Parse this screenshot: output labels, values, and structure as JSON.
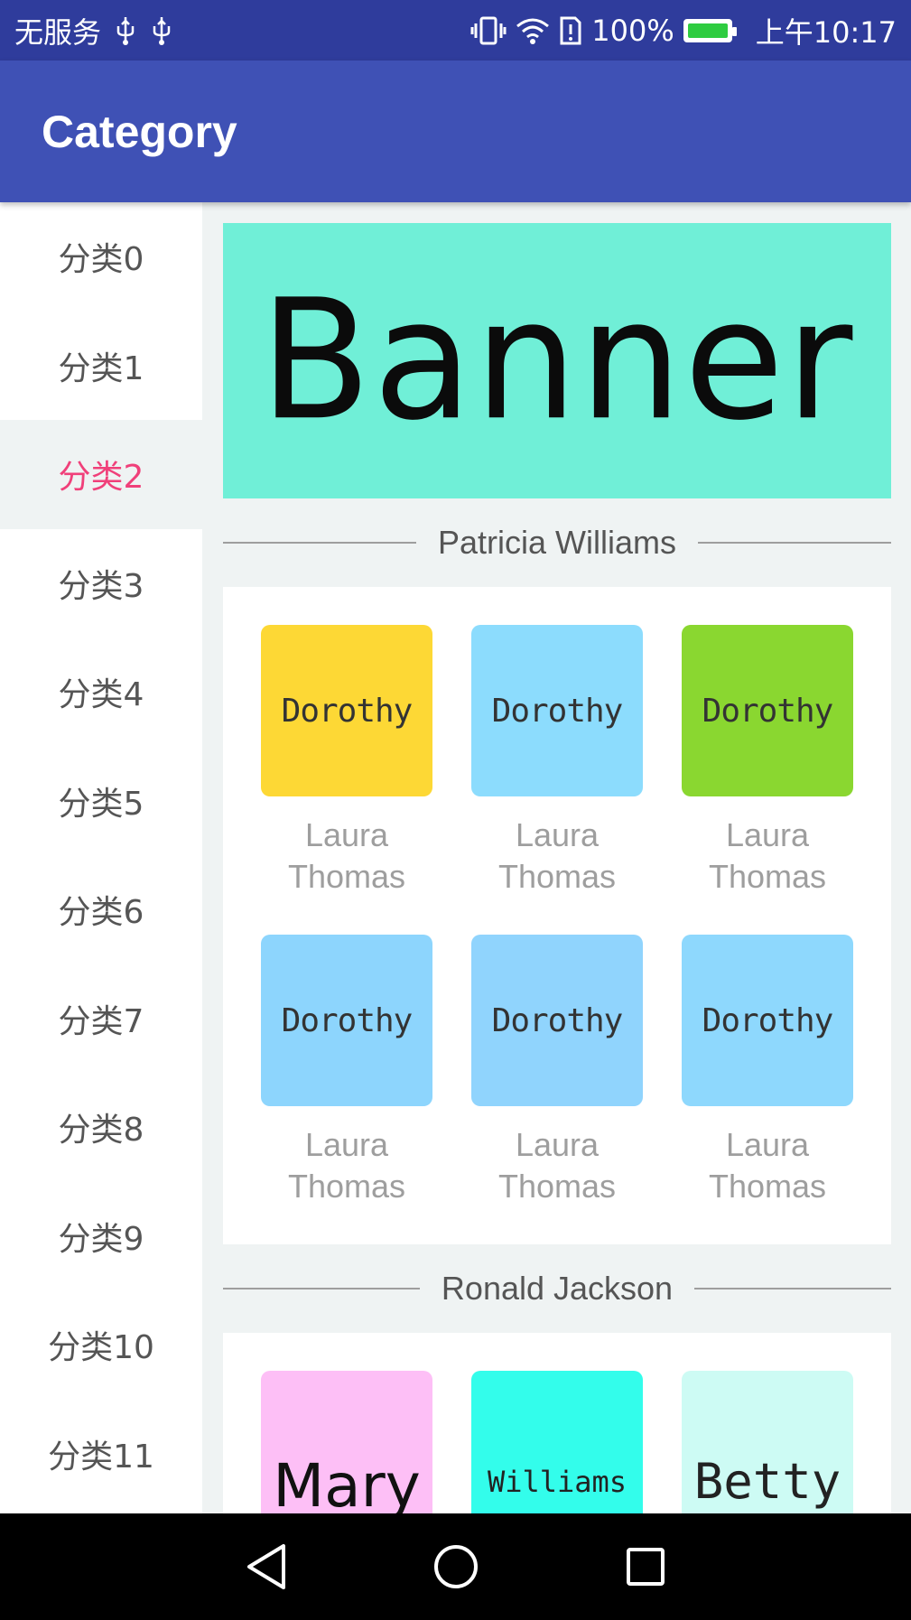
{
  "status_bar": {
    "carrier": "无服务",
    "battery": "100%",
    "time": "上午10:17"
  },
  "toolbar": {
    "title": "Category"
  },
  "categories": [
    {
      "label": "分类0"
    },
    {
      "label": "分类1"
    },
    {
      "label": "分类2",
      "selected": true
    },
    {
      "label": "分类3"
    },
    {
      "label": "分类4"
    },
    {
      "label": "分类5"
    },
    {
      "label": "分类6"
    },
    {
      "label": "分类7"
    },
    {
      "label": "分类8"
    },
    {
      "label": "分类9"
    },
    {
      "label": "分类10"
    },
    {
      "label": "分类11"
    }
  ],
  "banner": {
    "text": "Banner",
    "color": "#70efd7"
  },
  "sections": [
    {
      "title": "Patricia Williams",
      "items": [
        {
          "image_text": "Dorothy",
          "color": "#fdd835",
          "label_line1": "Laura",
          "label_line2": "Thomas"
        },
        {
          "image_text": "Dorothy",
          "color": "#8cdcfd",
          "label_line1": "Laura",
          "label_line2": "Thomas"
        },
        {
          "image_text": "Dorothy",
          "color": "#8ad730",
          "label_line1": "Laura",
          "label_line2": "Thomas"
        },
        {
          "image_text": "Dorothy",
          "color": "#8dd5fd",
          "label_line1": "Laura",
          "label_line2": "Thomas"
        },
        {
          "image_text": "Dorothy",
          "color": "#90d4fd",
          "label_line1": "Laura",
          "label_line2": "Thomas"
        },
        {
          "image_text": "Dorothy",
          "color": "#8ed8fd",
          "label_line1": "Laura",
          "label_line2": "Thomas"
        }
      ]
    },
    {
      "title": "Ronald Jackson",
      "items": [
        {
          "image_text": "Mary",
          "color": "#fdbff6"
        },
        {
          "image_text": "Williams",
          "color": "#33fdeb"
        },
        {
          "image_text": "Betty",
          "color": "#cdfbf4"
        }
      ]
    }
  ],
  "colors": {
    "status_bar": "#2f3c9c",
    "toolbar": "#3f51b5",
    "selected_category": "#f0407a",
    "background": "#eff3f3"
  }
}
